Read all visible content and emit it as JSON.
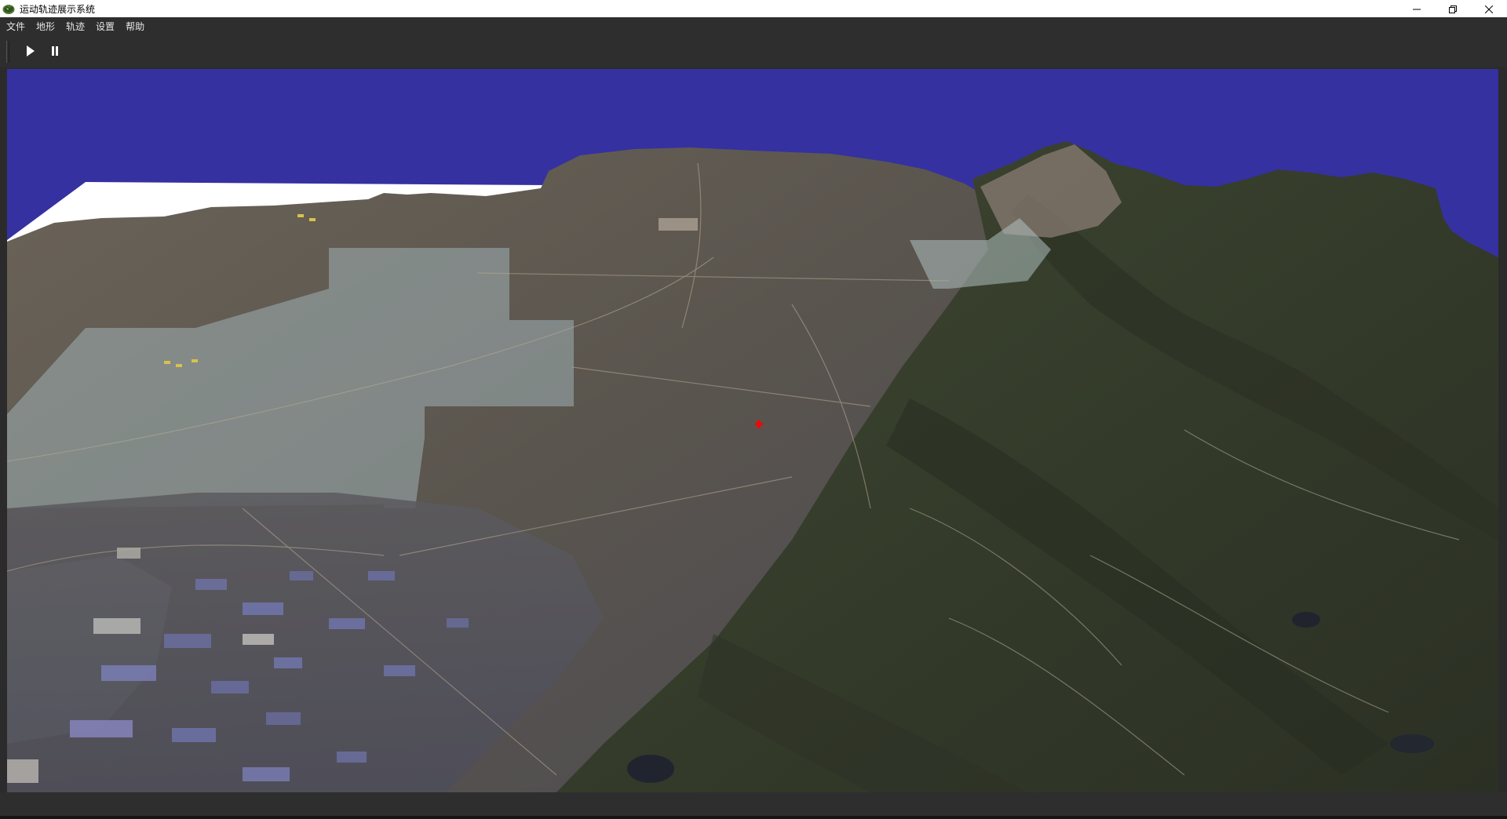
{
  "window": {
    "title": "运动轨迹展示系统",
    "app_icon": "globe-icon",
    "controls": {
      "minimize_icon": "minimize-icon",
      "restore_icon": "restore-icon",
      "close_icon": "close-icon"
    }
  },
  "menubar": {
    "items": [
      {
        "label": "文件"
      },
      {
        "label": "地形"
      },
      {
        "label": "轨迹"
      },
      {
        "label": "设置"
      },
      {
        "label": "帮助"
      }
    ]
  },
  "toolbar": {
    "play_icon": "play-icon",
    "pause_icon": "pause-icon"
  },
  "viewport": {
    "sky_color": "#3531a1",
    "terrain_base_color": "#ffffff",
    "trajectory_marker_color": "#ff0000",
    "marker_icon": "trajectory-marker-icon"
  }
}
